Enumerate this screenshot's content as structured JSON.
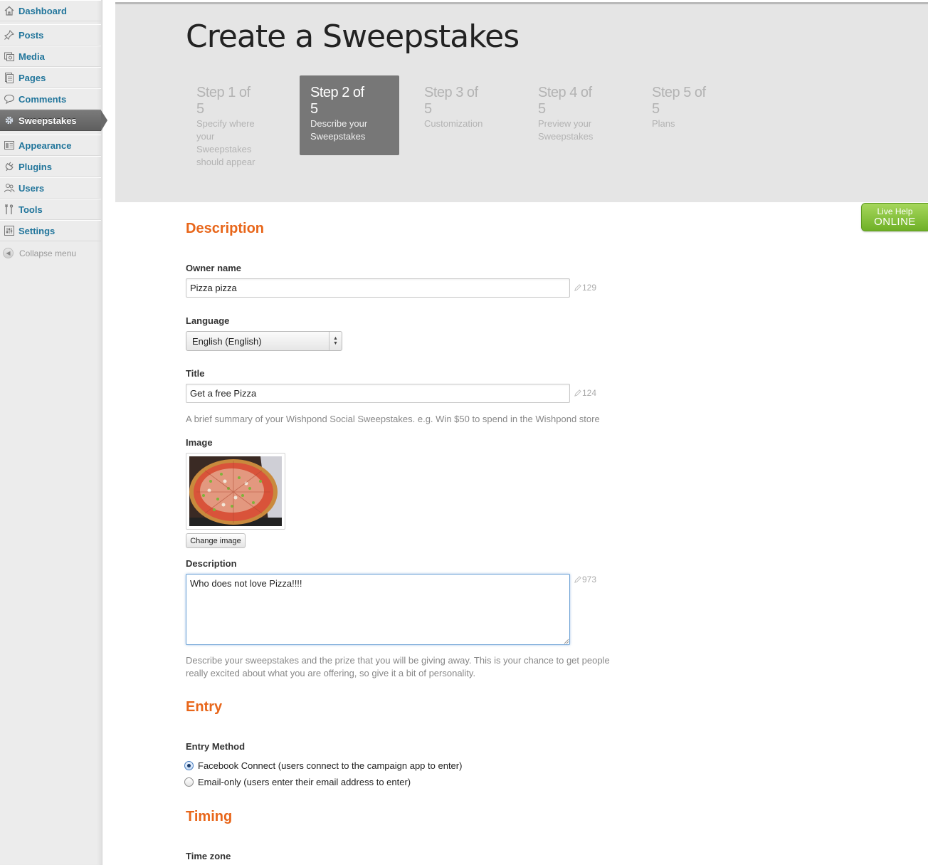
{
  "sidebar": {
    "items": [
      {
        "label": "Dashboard",
        "icon": "dashboard-icon"
      },
      {
        "label": "Posts",
        "icon": "pin-icon"
      },
      {
        "label": "Media",
        "icon": "media-icon"
      },
      {
        "label": "Pages",
        "icon": "pages-icon"
      },
      {
        "label": "Comments",
        "icon": "comment-icon"
      },
      {
        "label": "Sweepstakes",
        "icon": "gear-icon",
        "active": true
      },
      {
        "label": "Appearance",
        "icon": "appearance-icon"
      },
      {
        "label": "Plugins",
        "icon": "plugin-icon"
      },
      {
        "label": "Users",
        "icon": "users-icon"
      },
      {
        "label": "Tools",
        "icon": "tools-icon"
      },
      {
        "label": "Settings",
        "icon": "settings-icon"
      }
    ],
    "collapse_label": "Collapse menu"
  },
  "header": {
    "title": "Create a Sweepstakes",
    "steps": [
      {
        "label": "Step 1 of 5",
        "desc": "Specify where your Sweepstakes should appear"
      },
      {
        "label": "Step 2 of 5",
        "desc": "Describe your Sweepstakes",
        "current": true
      },
      {
        "label": "Step 3 of 5",
        "desc": "Customization"
      },
      {
        "label": "Step 4 of 5",
        "desc": "Preview your Sweepstakes"
      },
      {
        "label": "Step 5 of 5",
        "desc": "Plans"
      }
    ]
  },
  "live_help": {
    "line1": "Live Help",
    "line2": "ONLINE"
  },
  "description_section": {
    "heading": "Description",
    "owner_name": {
      "label": "Owner name",
      "value": "Pizza pizza",
      "remaining": "129"
    },
    "language": {
      "label": "Language",
      "selected": "English (English)"
    },
    "title": {
      "label": "Title",
      "value": "Get a free Pizza",
      "remaining": "124",
      "help": "A brief summary of your Wishpond Social Sweepstakes. e.g. Win $50 to spend in the Wishpond store"
    },
    "image": {
      "label": "Image",
      "button": "Change image"
    },
    "description": {
      "label": "Description",
      "value": "Who does not love Pizza!!!!",
      "remaining": "973",
      "help_line1": "Describe your sweepstakes and the prize that you will be giving away. This is your chance to get people",
      "help_line2": "really excited about what you are offering, so give it a bit of personality."
    }
  },
  "entry_section": {
    "heading": "Entry",
    "method_label": "Entry Method",
    "options": [
      {
        "label": "Facebook Connect (users connect to the campaign app to enter)",
        "checked": true
      },
      {
        "label": "Email-only (users enter their email address to enter)",
        "checked": false
      }
    ]
  },
  "timing_section": {
    "heading": "Timing",
    "timezone_label": "Time zone"
  },
  "colors": {
    "accent_orange": "#e8661a",
    "link_blue": "#21759b",
    "live_help_green": "#7ab833"
  }
}
